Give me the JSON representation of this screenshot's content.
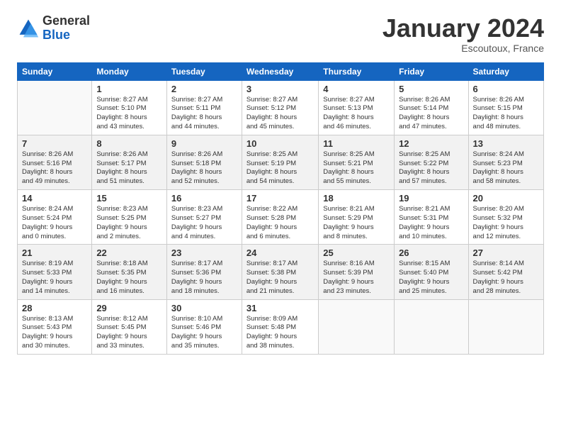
{
  "logo": {
    "general": "General",
    "blue": "Blue"
  },
  "header": {
    "month": "January 2024",
    "location": "Escoutoux, France"
  },
  "weekdays": [
    "Sunday",
    "Monday",
    "Tuesday",
    "Wednesday",
    "Thursday",
    "Friday",
    "Saturday"
  ],
  "weeks": [
    [
      {
        "day": "",
        "info": ""
      },
      {
        "day": "1",
        "info": "Sunrise: 8:27 AM\nSunset: 5:10 PM\nDaylight: 8 hours\nand 43 minutes."
      },
      {
        "day": "2",
        "info": "Sunrise: 8:27 AM\nSunset: 5:11 PM\nDaylight: 8 hours\nand 44 minutes."
      },
      {
        "day": "3",
        "info": "Sunrise: 8:27 AM\nSunset: 5:12 PM\nDaylight: 8 hours\nand 45 minutes."
      },
      {
        "day": "4",
        "info": "Sunrise: 8:27 AM\nSunset: 5:13 PM\nDaylight: 8 hours\nand 46 minutes."
      },
      {
        "day": "5",
        "info": "Sunrise: 8:26 AM\nSunset: 5:14 PM\nDaylight: 8 hours\nand 47 minutes."
      },
      {
        "day": "6",
        "info": "Sunrise: 8:26 AM\nSunset: 5:15 PM\nDaylight: 8 hours\nand 48 minutes."
      }
    ],
    [
      {
        "day": "7",
        "info": "Sunrise: 8:26 AM\nSunset: 5:16 PM\nDaylight: 8 hours\nand 49 minutes."
      },
      {
        "day": "8",
        "info": "Sunrise: 8:26 AM\nSunset: 5:17 PM\nDaylight: 8 hours\nand 51 minutes."
      },
      {
        "day": "9",
        "info": "Sunrise: 8:26 AM\nSunset: 5:18 PM\nDaylight: 8 hours\nand 52 minutes."
      },
      {
        "day": "10",
        "info": "Sunrise: 8:25 AM\nSunset: 5:19 PM\nDaylight: 8 hours\nand 54 minutes."
      },
      {
        "day": "11",
        "info": "Sunrise: 8:25 AM\nSunset: 5:21 PM\nDaylight: 8 hours\nand 55 minutes."
      },
      {
        "day": "12",
        "info": "Sunrise: 8:25 AM\nSunset: 5:22 PM\nDaylight: 8 hours\nand 57 minutes."
      },
      {
        "day": "13",
        "info": "Sunrise: 8:24 AM\nSunset: 5:23 PM\nDaylight: 8 hours\nand 58 minutes."
      }
    ],
    [
      {
        "day": "14",
        "info": "Sunrise: 8:24 AM\nSunset: 5:24 PM\nDaylight: 9 hours\nand 0 minutes."
      },
      {
        "day": "15",
        "info": "Sunrise: 8:23 AM\nSunset: 5:25 PM\nDaylight: 9 hours\nand 2 minutes."
      },
      {
        "day": "16",
        "info": "Sunrise: 8:23 AM\nSunset: 5:27 PM\nDaylight: 9 hours\nand 4 minutes."
      },
      {
        "day": "17",
        "info": "Sunrise: 8:22 AM\nSunset: 5:28 PM\nDaylight: 9 hours\nand 6 minutes."
      },
      {
        "day": "18",
        "info": "Sunrise: 8:21 AM\nSunset: 5:29 PM\nDaylight: 9 hours\nand 8 minutes."
      },
      {
        "day": "19",
        "info": "Sunrise: 8:21 AM\nSunset: 5:31 PM\nDaylight: 9 hours\nand 10 minutes."
      },
      {
        "day": "20",
        "info": "Sunrise: 8:20 AM\nSunset: 5:32 PM\nDaylight: 9 hours\nand 12 minutes."
      }
    ],
    [
      {
        "day": "21",
        "info": "Sunrise: 8:19 AM\nSunset: 5:33 PM\nDaylight: 9 hours\nand 14 minutes."
      },
      {
        "day": "22",
        "info": "Sunrise: 8:18 AM\nSunset: 5:35 PM\nDaylight: 9 hours\nand 16 minutes."
      },
      {
        "day": "23",
        "info": "Sunrise: 8:17 AM\nSunset: 5:36 PM\nDaylight: 9 hours\nand 18 minutes."
      },
      {
        "day": "24",
        "info": "Sunrise: 8:17 AM\nSunset: 5:38 PM\nDaylight: 9 hours\nand 21 minutes."
      },
      {
        "day": "25",
        "info": "Sunrise: 8:16 AM\nSunset: 5:39 PM\nDaylight: 9 hours\nand 23 minutes."
      },
      {
        "day": "26",
        "info": "Sunrise: 8:15 AM\nSunset: 5:40 PM\nDaylight: 9 hours\nand 25 minutes."
      },
      {
        "day": "27",
        "info": "Sunrise: 8:14 AM\nSunset: 5:42 PM\nDaylight: 9 hours\nand 28 minutes."
      }
    ],
    [
      {
        "day": "28",
        "info": "Sunrise: 8:13 AM\nSunset: 5:43 PM\nDaylight: 9 hours\nand 30 minutes."
      },
      {
        "day": "29",
        "info": "Sunrise: 8:12 AM\nSunset: 5:45 PM\nDaylight: 9 hours\nand 33 minutes."
      },
      {
        "day": "30",
        "info": "Sunrise: 8:10 AM\nSunset: 5:46 PM\nDaylight: 9 hours\nand 35 minutes."
      },
      {
        "day": "31",
        "info": "Sunrise: 8:09 AM\nSunset: 5:48 PM\nDaylight: 9 hours\nand 38 minutes."
      },
      {
        "day": "",
        "info": ""
      },
      {
        "day": "",
        "info": ""
      },
      {
        "day": "",
        "info": ""
      }
    ]
  ]
}
